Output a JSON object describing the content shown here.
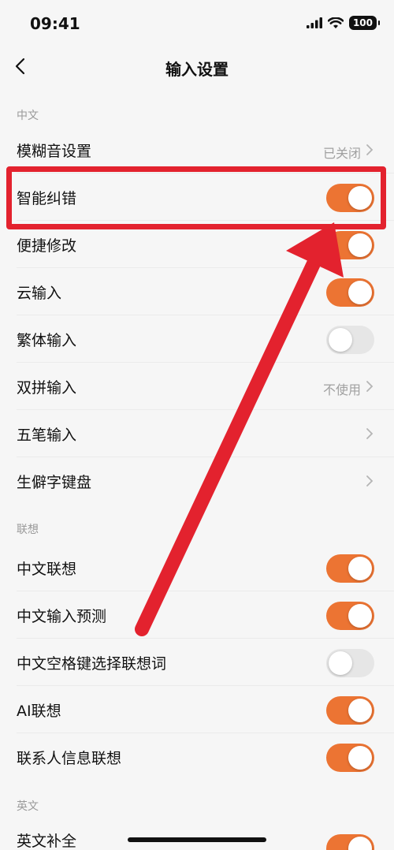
{
  "status": {
    "time": "09:41",
    "battery": "100"
  },
  "nav": {
    "title": "输入设置"
  },
  "sections": {
    "chinese": "中文",
    "association": "联想",
    "english": "英文"
  },
  "rows": {
    "fuzzy": {
      "label": "模糊音设置",
      "value": "已关闭"
    },
    "smart": {
      "label": "智能纠错",
      "on": true
    },
    "quick": {
      "label": "便捷修改",
      "on": true
    },
    "cloud": {
      "label": "云输入",
      "on": true
    },
    "traditional": {
      "label": "繁体输入",
      "on": false
    },
    "shuangpin": {
      "label": "双拼输入",
      "value": "不使用"
    },
    "wubi": {
      "label": "五笔输入"
    },
    "rare": {
      "label": "生僻字键盘"
    },
    "cn_assoc": {
      "label": "中文联想",
      "on": true
    },
    "cn_predict": {
      "label": "中文输入预测",
      "on": true
    },
    "space_assoc": {
      "label": "中文空格键选择联想词",
      "on": false
    },
    "ai_assoc": {
      "label": "AI联想",
      "on": true
    },
    "contact_assoc": {
      "label": "联系人信息联想",
      "on": true
    },
    "en_complete": {
      "label": "英文补全",
      "on": true
    }
  },
  "colors": {
    "accent": "#ec7433",
    "highlight": "#e3222e",
    "toggle_off": "#e6e6e6"
  }
}
